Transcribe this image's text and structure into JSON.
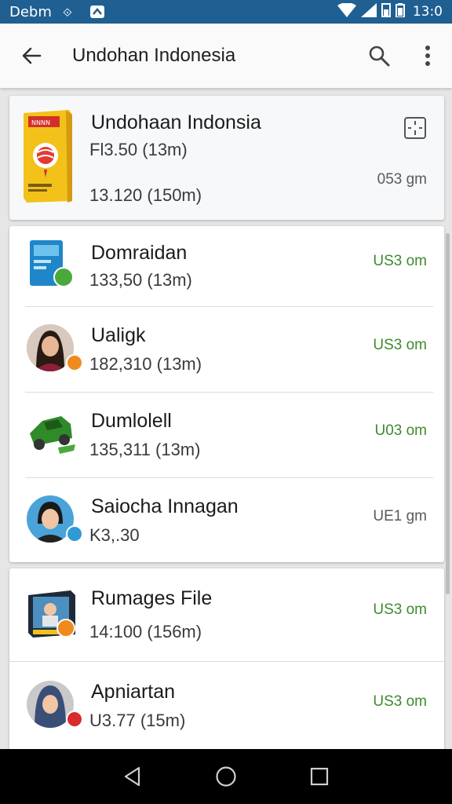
{
  "status_bar": {
    "carrier": "Debm",
    "time": "13:0"
  },
  "app_bar": {
    "title": "Undohan Indonesia",
    "back_icon": "arrow-back-icon",
    "search_icon": "search-icon",
    "menu_icon": "more-vert-icon"
  },
  "featured": {
    "title": "Undohaan Indonsia",
    "line1": "Fl3.50 (13m)",
    "line2": "13.120 (150m)",
    "meta": "053 gm",
    "action_icon": "grid-icon"
  },
  "items": [
    {
      "title": "Domraidan",
      "subtitle": "133,50 (13m)",
      "price": "US3 om"
    },
    {
      "title": "Ualigk",
      "subtitle": "182,310 (13m)",
      "price": "US3 om"
    },
    {
      "title": "Dumlolell",
      "subtitle": "135,311 (13m)",
      "price": "U03 om"
    },
    {
      "title": "Saiocha Innagan",
      "subtitle": "K3,.30",
      "price": "UE1 gm"
    },
    {
      "title": "Rumages File",
      "subtitle": "14:100 (156m)",
      "price": "US3 om"
    },
    {
      "title": "Apniartan",
      "subtitle": "U3.77 (15m)",
      "price": "US3 om"
    }
  ],
  "colors": {
    "status_bar": "#1f5f92",
    "price_green": "#3d8b2e"
  }
}
